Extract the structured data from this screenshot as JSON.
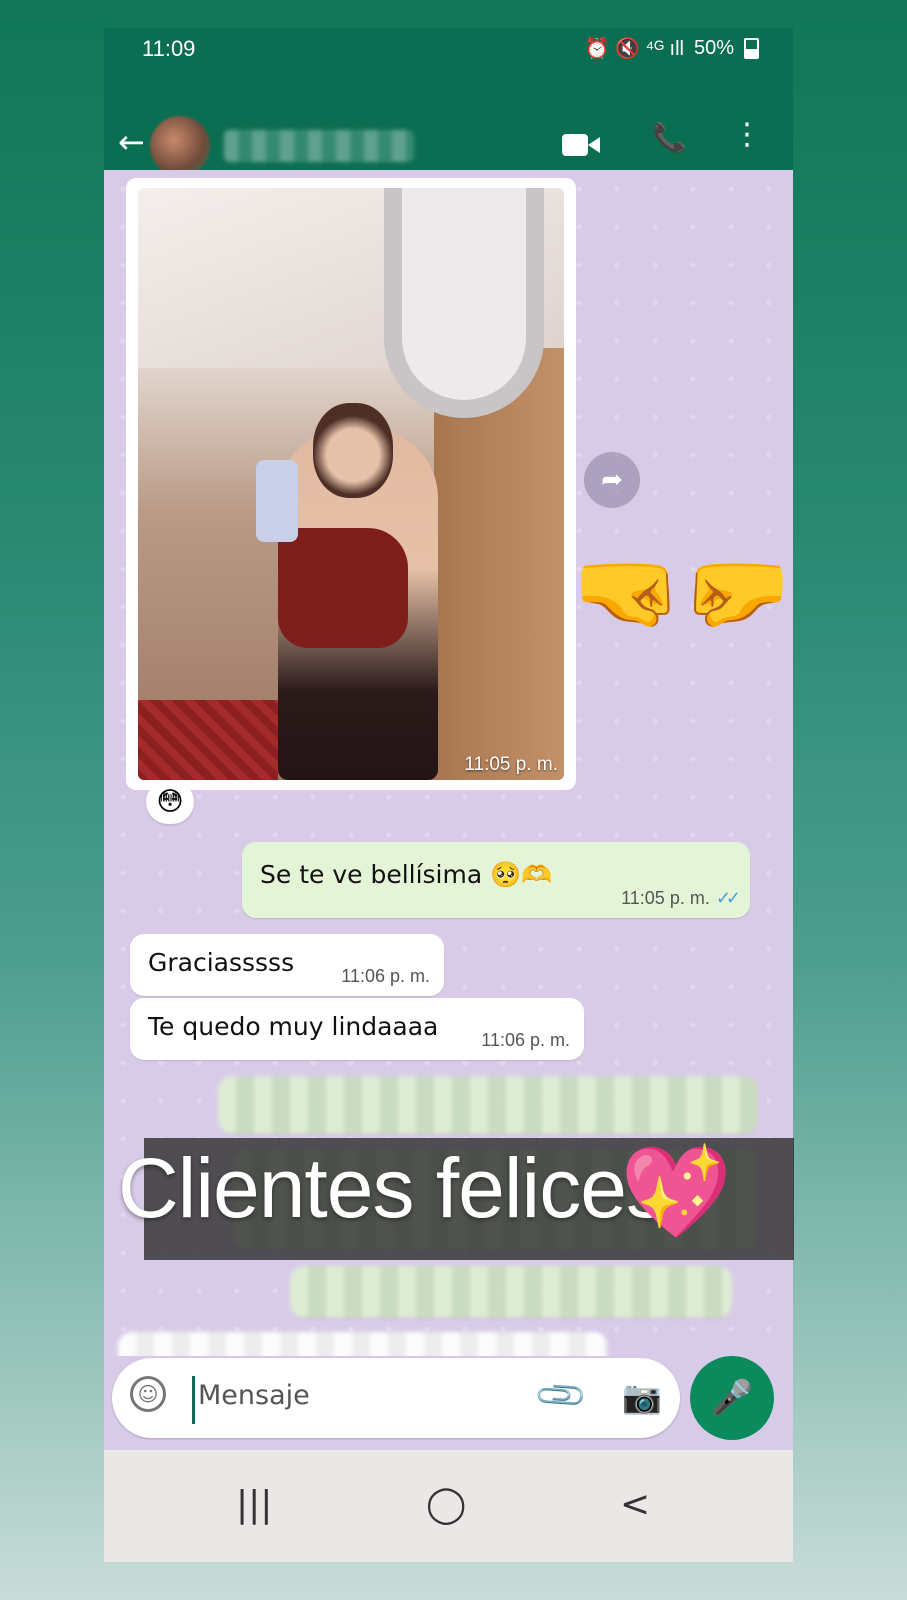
{
  "status_bar": {
    "time": "11:09",
    "icons": "⏰ 🔇 ⁴ᴳ ıll",
    "battery": "50%"
  },
  "header": {
    "back_icon": "arrow-left-icon",
    "video_icon": "video-call-icon",
    "phone_icon": "phone-icon",
    "menu_icon": "more-vert-icon"
  },
  "chat": {
    "image_message": {
      "time": "11:05 p. m.",
      "reaction": "😳"
    },
    "messages": [
      {
        "direction": "out",
        "text": "Se te ve bellísima 🥺🫶",
        "time": "11:05 p. m.",
        "ticks": "✓✓"
      },
      {
        "direction": "in",
        "text": "Graciasssss",
        "time": "11:06 p. m."
      },
      {
        "direction": "in",
        "text": "Te quedo muy lindaaaa",
        "time": "11:06 p. m."
      }
    ]
  },
  "overlay": {
    "caption": "Clientes felices",
    "heart_sticker": "💖",
    "fist_sticker": "🤜🤛"
  },
  "input": {
    "placeholder": "Mensaje"
  },
  "nav": {
    "recents": "|||",
    "home": "◯",
    "back": "<"
  },
  "colors": {
    "header_green": "#0b6e52",
    "chat_bg": "#d8cbe8",
    "outgoing_bubble": "#e4f5d7",
    "mic_button": "#0b8a5e",
    "read_ticks": "#4aa0d8"
  }
}
